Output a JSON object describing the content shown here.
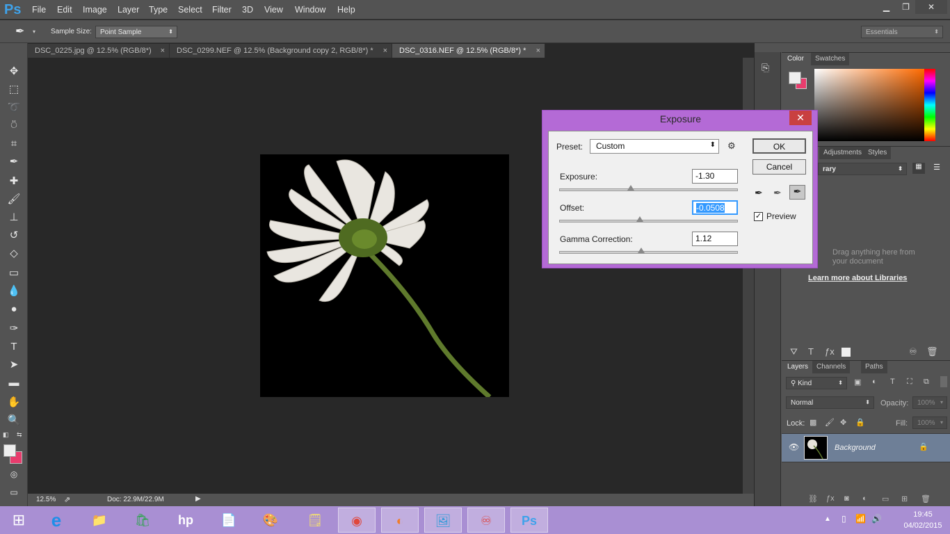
{
  "app": {
    "logo": "Ps"
  },
  "menu": [
    "File",
    "Edit",
    "Image",
    "Layer",
    "Type",
    "Select",
    "Filter",
    "3D",
    "View",
    "Window",
    "Help"
  ],
  "window_controls": {
    "minimize": "▁",
    "restore": "❐",
    "close": "✕"
  },
  "options_bar": {
    "sample_size_label": "Sample Size:",
    "sample_size_value": "Point Sample",
    "workspace": "Essentials"
  },
  "tabs": [
    {
      "label": "DSC_0225.jpg @ 12.5% (RGB/8*)",
      "close": "×"
    },
    {
      "label": "DSC_0299.NEF @ 12.5% (Background copy 2, RGB/8*) *",
      "close": "×"
    },
    {
      "label": "DSC_0316.NEF @ 12.5% (RGB/8*) *",
      "close": "×"
    }
  ],
  "status": {
    "zoom": "12.5%",
    "doc": "Doc: 22.9M/22.9M"
  },
  "color_panel": {
    "tabs": [
      "Color",
      "Swatches"
    ]
  },
  "libraries_panel": {
    "tabs": [
      "Adjustments",
      "Styles"
    ],
    "dropdown": "rary",
    "drag_hint_1": "Drag anything here from",
    "drag_hint_2": "your document",
    "learn_link": "Learn more about Libraries"
  },
  "layers_panel": {
    "tabs": [
      "Layers",
      "Channels",
      "Paths"
    ],
    "kind": "Kind",
    "blend_mode": "Normal",
    "opacity_label": "Opacity:",
    "opacity_value": "100%",
    "lock_label": "Lock:",
    "fill_label": "Fill:",
    "fill_value": "100%",
    "layer_name": "Background"
  },
  "dialog": {
    "title": "Exposure",
    "close": "✕",
    "preset_label": "Preset:",
    "preset_value": "Custom",
    "exposure_label": "Exposure:",
    "exposure_value": "-1.30",
    "exposure_slider": 0.4,
    "offset_label": "Offset:",
    "offset_value": "-0.0508",
    "offset_slider": 0.45,
    "gamma_label": "Gamma Correction:",
    "gamma_value": "1.12",
    "gamma_slider": 0.46,
    "ok": "OK",
    "cancel": "Cancel",
    "preview_label": "Preview",
    "preview_checked": true
  },
  "taskbar": {
    "time": "19:45",
    "date": "04/02/2015"
  },
  "colors": {
    "accent": "#3fa2ea",
    "dialog_frame": "#b46ad6",
    "taskbar": "#a98fd3",
    "layer_selected": "#6e7f97"
  }
}
